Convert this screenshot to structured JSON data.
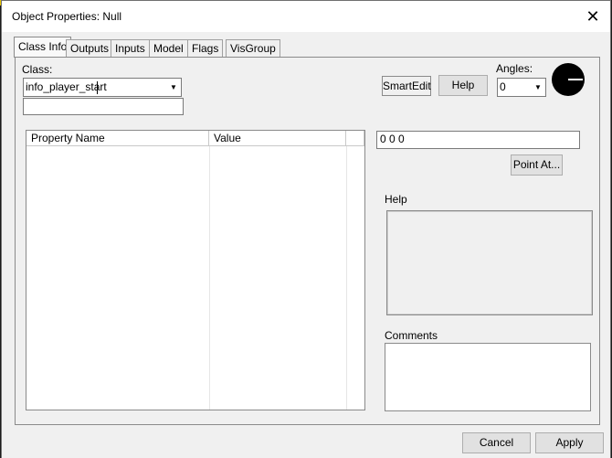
{
  "window": {
    "title": "Object Properties: Null"
  },
  "tabs": [
    "Class Info",
    "Outputs",
    "Inputs",
    "Model",
    "Flags",
    "VisGroup"
  ],
  "class_info": {
    "class_label": "Class:",
    "class_value": "info_player_start",
    "smartedit_label": "SmartEdit",
    "help_button_label": "Help",
    "angles_label": "Angles:",
    "angles_value": "0",
    "grid_headers": [
      "Property Name",
      "Value"
    ],
    "value_field": "0 0 0",
    "point_at_label": "Point At...",
    "help_label": "Help",
    "comments_label": "Comments"
  },
  "footer": {
    "cancel_label": "Cancel",
    "apply_label": "Apply"
  }
}
